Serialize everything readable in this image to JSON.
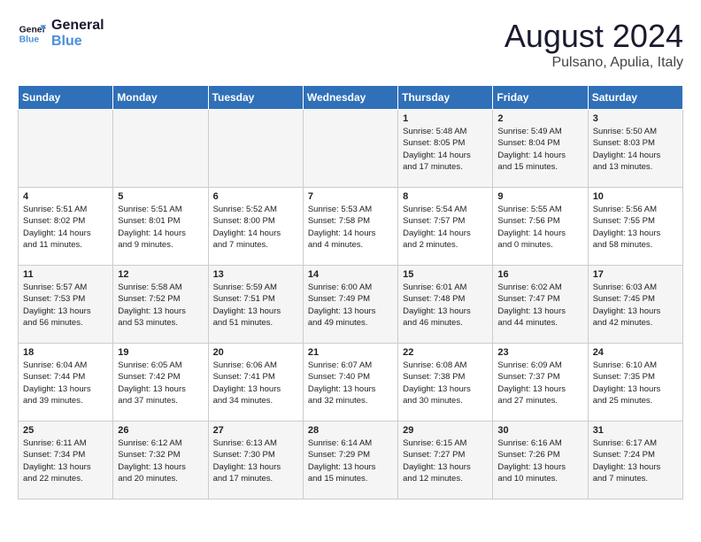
{
  "header": {
    "logo_line1": "General",
    "logo_line2": "Blue",
    "title": "August 2024",
    "subtitle": "Pulsano, Apulia, Italy"
  },
  "weekdays": [
    "Sunday",
    "Monday",
    "Tuesday",
    "Wednesday",
    "Thursday",
    "Friday",
    "Saturday"
  ],
  "weeks": [
    [
      {
        "num": "",
        "info": ""
      },
      {
        "num": "",
        "info": ""
      },
      {
        "num": "",
        "info": ""
      },
      {
        "num": "",
        "info": ""
      },
      {
        "num": "1",
        "info": "Sunrise: 5:48 AM\nSunset: 8:05 PM\nDaylight: 14 hours\nand 17 minutes."
      },
      {
        "num": "2",
        "info": "Sunrise: 5:49 AM\nSunset: 8:04 PM\nDaylight: 14 hours\nand 15 minutes."
      },
      {
        "num": "3",
        "info": "Sunrise: 5:50 AM\nSunset: 8:03 PM\nDaylight: 14 hours\nand 13 minutes."
      }
    ],
    [
      {
        "num": "4",
        "info": "Sunrise: 5:51 AM\nSunset: 8:02 PM\nDaylight: 14 hours\nand 11 minutes."
      },
      {
        "num": "5",
        "info": "Sunrise: 5:51 AM\nSunset: 8:01 PM\nDaylight: 14 hours\nand 9 minutes."
      },
      {
        "num": "6",
        "info": "Sunrise: 5:52 AM\nSunset: 8:00 PM\nDaylight: 14 hours\nand 7 minutes."
      },
      {
        "num": "7",
        "info": "Sunrise: 5:53 AM\nSunset: 7:58 PM\nDaylight: 14 hours\nand 4 minutes."
      },
      {
        "num": "8",
        "info": "Sunrise: 5:54 AM\nSunset: 7:57 PM\nDaylight: 14 hours\nand 2 minutes."
      },
      {
        "num": "9",
        "info": "Sunrise: 5:55 AM\nSunset: 7:56 PM\nDaylight: 14 hours\nand 0 minutes."
      },
      {
        "num": "10",
        "info": "Sunrise: 5:56 AM\nSunset: 7:55 PM\nDaylight: 13 hours\nand 58 minutes."
      }
    ],
    [
      {
        "num": "11",
        "info": "Sunrise: 5:57 AM\nSunset: 7:53 PM\nDaylight: 13 hours\nand 56 minutes."
      },
      {
        "num": "12",
        "info": "Sunrise: 5:58 AM\nSunset: 7:52 PM\nDaylight: 13 hours\nand 53 minutes."
      },
      {
        "num": "13",
        "info": "Sunrise: 5:59 AM\nSunset: 7:51 PM\nDaylight: 13 hours\nand 51 minutes."
      },
      {
        "num": "14",
        "info": "Sunrise: 6:00 AM\nSunset: 7:49 PM\nDaylight: 13 hours\nand 49 minutes."
      },
      {
        "num": "15",
        "info": "Sunrise: 6:01 AM\nSunset: 7:48 PM\nDaylight: 13 hours\nand 46 minutes."
      },
      {
        "num": "16",
        "info": "Sunrise: 6:02 AM\nSunset: 7:47 PM\nDaylight: 13 hours\nand 44 minutes."
      },
      {
        "num": "17",
        "info": "Sunrise: 6:03 AM\nSunset: 7:45 PM\nDaylight: 13 hours\nand 42 minutes."
      }
    ],
    [
      {
        "num": "18",
        "info": "Sunrise: 6:04 AM\nSunset: 7:44 PM\nDaylight: 13 hours\nand 39 minutes."
      },
      {
        "num": "19",
        "info": "Sunrise: 6:05 AM\nSunset: 7:42 PM\nDaylight: 13 hours\nand 37 minutes."
      },
      {
        "num": "20",
        "info": "Sunrise: 6:06 AM\nSunset: 7:41 PM\nDaylight: 13 hours\nand 34 minutes."
      },
      {
        "num": "21",
        "info": "Sunrise: 6:07 AM\nSunset: 7:40 PM\nDaylight: 13 hours\nand 32 minutes."
      },
      {
        "num": "22",
        "info": "Sunrise: 6:08 AM\nSunset: 7:38 PM\nDaylight: 13 hours\nand 30 minutes."
      },
      {
        "num": "23",
        "info": "Sunrise: 6:09 AM\nSunset: 7:37 PM\nDaylight: 13 hours\nand 27 minutes."
      },
      {
        "num": "24",
        "info": "Sunrise: 6:10 AM\nSunset: 7:35 PM\nDaylight: 13 hours\nand 25 minutes."
      }
    ],
    [
      {
        "num": "25",
        "info": "Sunrise: 6:11 AM\nSunset: 7:34 PM\nDaylight: 13 hours\nand 22 minutes."
      },
      {
        "num": "26",
        "info": "Sunrise: 6:12 AM\nSunset: 7:32 PM\nDaylight: 13 hours\nand 20 minutes."
      },
      {
        "num": "27",
        "info": "Sunrise: 6:13 AM\nSunset: 7:30 PM\nDaylight: 13 hours\nand 17 minutes."
      },
      {
        "num": "28",
        "info": "Sunrise: 6:14 AM\nSunset: 7:29 PM\nDaylight: 13 hours\nand 15 minutes."
      },
      {
        "num": "29",
        "info": "Sunrise: 6:15 AM\nSunset: 7:27 PM\nDaylight: 13 hours\nand 12 minutes."
      },
      {
        "num": "30",
        "info": "Sunrise: 6:16 AM\nSunset: 7:26 PM\nDaylight: 13 hours\nand 10 minutes."
      },
      {
        "num": "31",
        "info": "Sunrise: 6:17 AM\nSunset: 7:24 PM\nDaylight: 13 hours\nand 7 minutes."
      }
    ]
  ]
}
